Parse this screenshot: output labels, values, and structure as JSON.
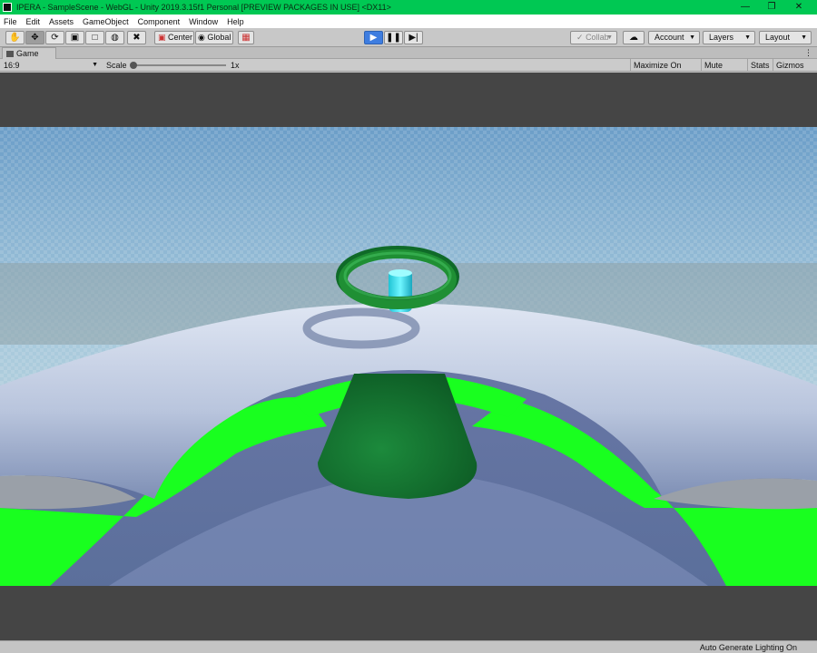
{
  "window": {
    "title": "IPERA - SampleScene - WebGL - Unity 2019.3.15f1 Personal [PREVIEW PACKAGES IN USE] <DX11>",
    "controls": [
      "minimize-icon",
      "maximize-icon",
      "close-icon"
    ]
  },
  "menu": [
    "File",
    "Edit",
    "Assets",
    "GameObject",
    "Component",
    "Window",
    "Help"
  ],
  "toolbar": {
    "tools": [
      "hand-tool-icon",
      "move-tool-icon",
      "rotate-tool-icon",
      "scale-tool-icon",
      "rect-tool-icon",
      "transform-tool-icon",
      "custom-tool-icon"
    ],
    "pivot_label": "Center",
    "space_label": "Global",
    "collab_label": "Collab",
    "account_label": "Account",
    "layers_label": "Layers",
    "layout_label": "Layout",
    "play_active": true
  },
  "game_tab": {
    "label": "Game"
  },
  "game_view": {
    "aspect": "16:9",
    "scale_label": "Scale",
    "scale_value": "1x",
    "options": [
      "Maximize On Play",
      "Mute Audio",
      "Stats",
      "Gizmos"
    ]
  },
  "status": {
    "text": "Auto Generate Lighting On"
  },
  "colors": {
    "title_bar": "#00c853",
    "play_button": "#3e7de0",
    "ring": "#1f8f34",
    "beacon": "#38e6f2",
    "ground_green": "#19ff1f"
  }
}
